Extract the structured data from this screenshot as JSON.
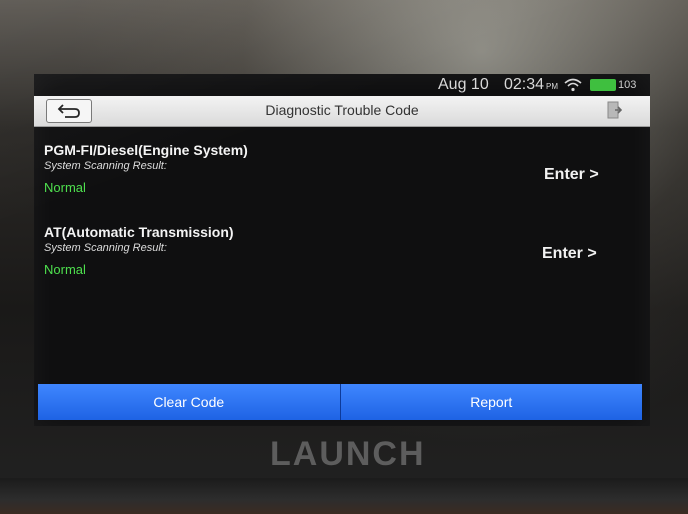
{
  "status_bar": {
    "date": "Aug 10",
    "time": "02:34",
    "ampm": "PM",
    "battery": "103"
  },
  "header": {
    "title": "Diagnostic Trouble Code",
    "back_icon": "back-arrow-icon",
    "exit_icon": "exit-icon"
  },
  "systems": [
    {
      "name": "PGM-FI/Diesel(Engine System)",
      "result_label": "System Scanning Result:",
      "status": "Normal",
      "enter_label": "Enter >"
    },
    {
      "name": "AT(Automatic Transmission)",
      "result_label": "System Scanning Result:",
      "status": "Normal",
      "enter_label": "Enter >"
    }
  ],
  "footer": {
    "clear_label": "Clear Code",
    "report_label": "Report"
  },
  "device": {
    "brand": "LAUNCH"
  },
  "colors": {
    "accent_blue": "#2f74f2",
    "status_green": "#4ee04e",
    "battery_green": "#3fbf3f"
  }
}
